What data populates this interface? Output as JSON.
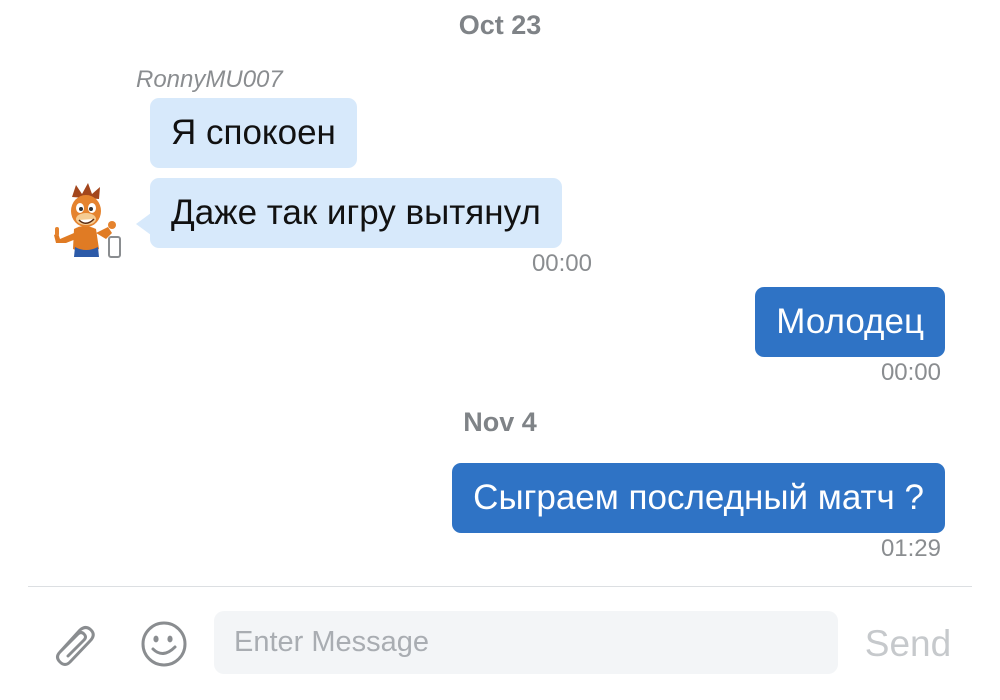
{
  "dates": [
    "Oct 23",
    "Nov 4"
  ],
  "sender_name": "RonnyMU007",
  "messages": [
    {
      "text": "Я спокоен"
    },
    {
      "text": "Даже так игру вытянул",
      "time": "00:00"
    },
    {
      "text": "Молодец",
      "time": "00:00"
    },
    {
      "text": "Сыграем последный матч ?",
      "time": "01:29"
    }
  ],
  "composer": {
    "placeholder": "Enter Message",
    "send_label": "Send",
    "attach_icon": "paperclip-icon",
    "emoji_icon": "emoji-icon"
  },
  "colors": {
    "incoming_bubble": "#d7e9fb",
    "outgoing_bubble": "#2f73c5",
    "meta_text": "#8a8d90",
    "send_disabled": "#c6c9cc"
  }
}
